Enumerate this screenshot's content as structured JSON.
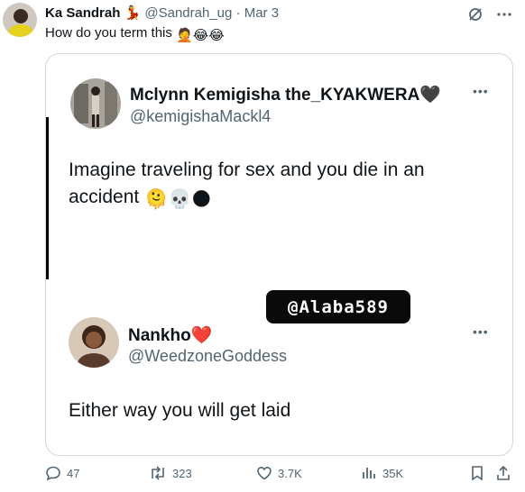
{
  "tweet": {
    "author_name": "Ka Sandrah",
    "author_emoji": "💃",
    "author_handle": "@Sandrah_ug",
    "separator": "·",
    "date": "Mar 3",
    "text": "How do you term this",
    "text_emojis": "🤦😂😂"
  },
  "quoted": {
    "user1": {
      "name": "Mclynn Kemigisha the_KYAKWERA",
      "name_emoji": "🖤",
      "handle": "@kemigishaMackl4",
      "text": "Imagine traveling for sex and you die in an accident",
      "text_emojis": "🫠💀🌑"
    },
    "watermark": "@Alaba589",
    "user2": {
      "name": "Nankho",
      "name_emoji": "❤️",
      "handle": "@WeedzoneGoddess",
      "text": "Either way you will get laid"
    }
  },
  "actions": {
    "replies": "47",
    "retweets": "323",
    "likes": "3.7K",
    "views": "35K"
  },
  "icons": [
    "grok-icon",
    "more-icon",
    "reply-icon",
    "retweet-icon",
    "like-icon",
    "views-icon",
    "bookmark-icon",
    "share-icon"
  ],
  "colors": {
    "text": "#0f1419",
    "muted": "#536471",
    "border": "#cfd9de"
  }
}
